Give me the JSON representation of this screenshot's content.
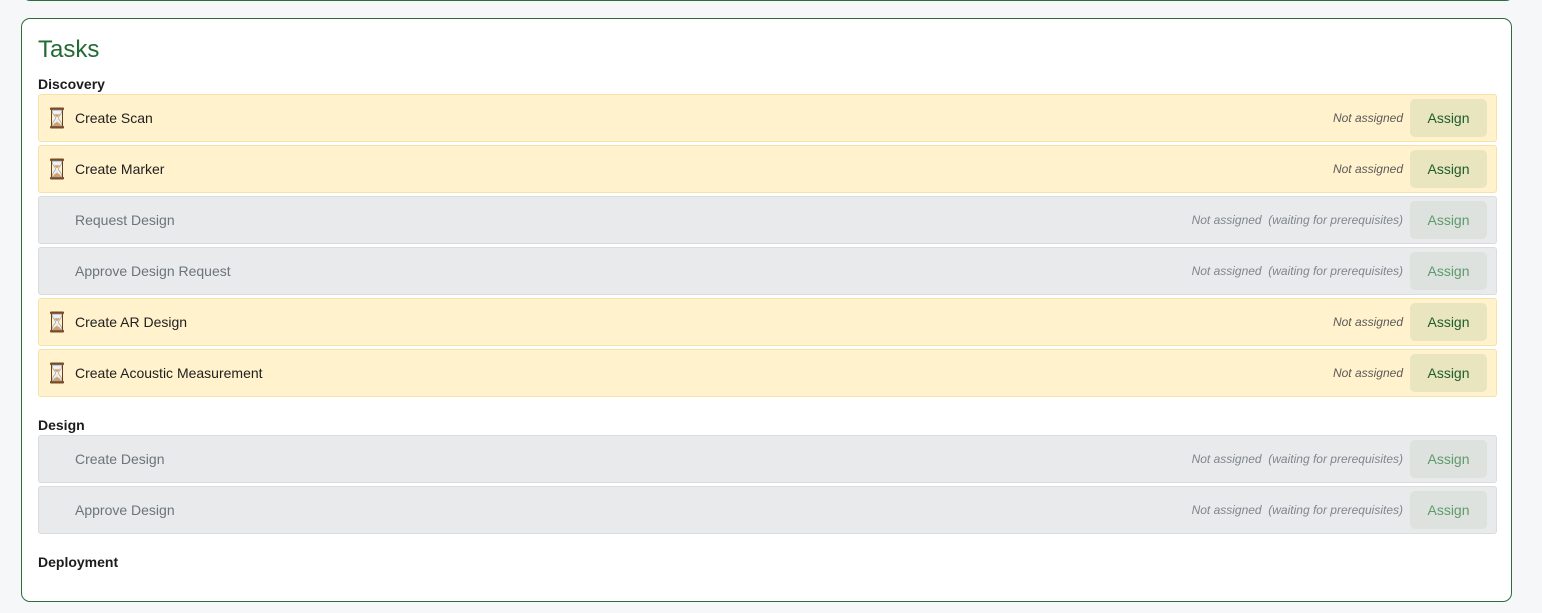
{
  "panel": {
    "title": "Tasks"
  },
  "sections": {
    "discovery": {
      "title": "Discovery",
      "tasks": [
        {
          "name": "Create Scan",
          "status": "Not assigned",
          "assign_label": "Assign",
          "state": "active"
        },
        {
          "name": "Create Marker",
          "status": "Not assigned",
          "assign_label": "Assign",
          "state": "active"
        },
        {
          "name": "Request Design",
          "status": "Not assigned  (waiting for prerequisites)",
          "assign_label": "Assign",
          "state": "waiting"
        },
        {
          "name": "Approve Design Request",
          "status": "Not assigned  (waiting for prerequisites)",
          "assign_label": "Assign",
          "state": "waiting"
        },
        {
          "name": "Create AR Design",
          "status": "Not assigned",
          "assign_label": "Assign",
          "state": "active"
        },
        {
          "name": "Create Acoustic Measurement",
          "status": "Not assigned",
          "assign_label": "Assign",
          "state": "active"
        }
      ]
    },
    "design": {
      "title": "Design",
      "tasks": [
        {
          "name": "Create Design",
          "status": "Not assigned  (waiting for prerequisites)",
          "assign_label": "Assign",
          "state": "waiting"
        },
        {
          "name": "Approve Design",
          "status": "Not assigned  (waiting for prerequisites)",
          "assign_label": "Assign",
          "state": "waiting"
        }
      ]
    },
    "deployment": {
      "title": "Deployment",
      "tasks": []
    }
  },
  "icons": {
    "active_task": "hourglass-icon"
  },
  "colors": {
    "accent": "#226b32",
    "active_row": "#fff2cc",
    "waiting_row": "#e9eaeb",
    "assign_active": "#e8e5bf",
    "assign_waiting": "#dde2de"
  }
}
